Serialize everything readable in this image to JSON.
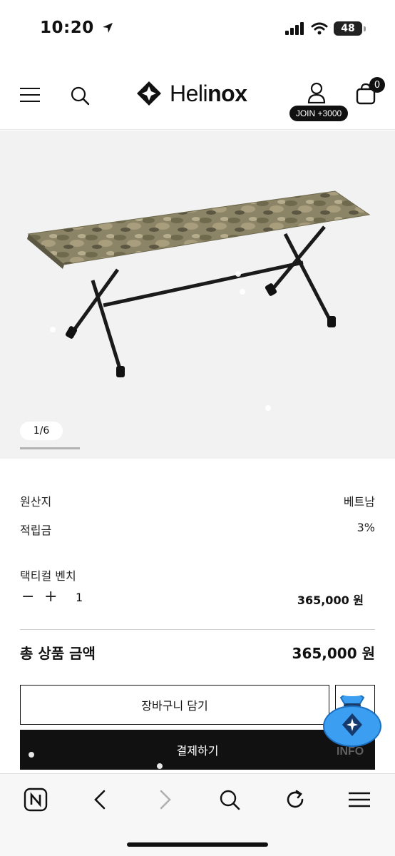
{
  "status_bar": {
    "time": "10:20",
    "battery": "48"
  },
  "header": {
    "logo_text_light": "Heli",
    "logo_text_bold": "nox",
    "join_badge": "JOIN +3000",
    "cart_count": "0",
    "icons": [
      "menu-icon",
      "search-icon",
      "helinox-logo-icon",
      "user-icon",
      "shopping-bag-icon"
    ]
  },
  "gallery": {
    "page_indicator": "1/6",
    "progress": 0.1667
  },
  "product_info": {
    "rows": [
      {
        "label": "원산지",
        "value": "베트남"
      },
      {
        "label": "적립금",
        "value": "3%"
      }
    ]
  },
  "option": {
    "name": "택티컬 벤치",
    "minus_label": "−",
    "plus_label": "+",
    "quantity": "1",
    "price": "365,000 원"
  },
  "total": {
    "label": "총 상품 금액",
    "value": "365,000 원"
  },
  "buttons": {
    "add_to_cart": "장바구니 담기",
    "checkout": "결제하기",
    "info_floating": "INFO"
  },
  "browser_bar": {
    "icons": [
      "naver-n-icon",
      "back-arrow-icon",
      "forward-arrow-icon",
      "search-icon",
      "refresh-icon",
      "menu-icon"
    ]
  },
  "colors": {
    "primary": "#111111",
    "background_gallery": "#f2f2f2",
    "divider": "#cfcfcf",
    "info_bag": "#2f8fe6"
  }
}
